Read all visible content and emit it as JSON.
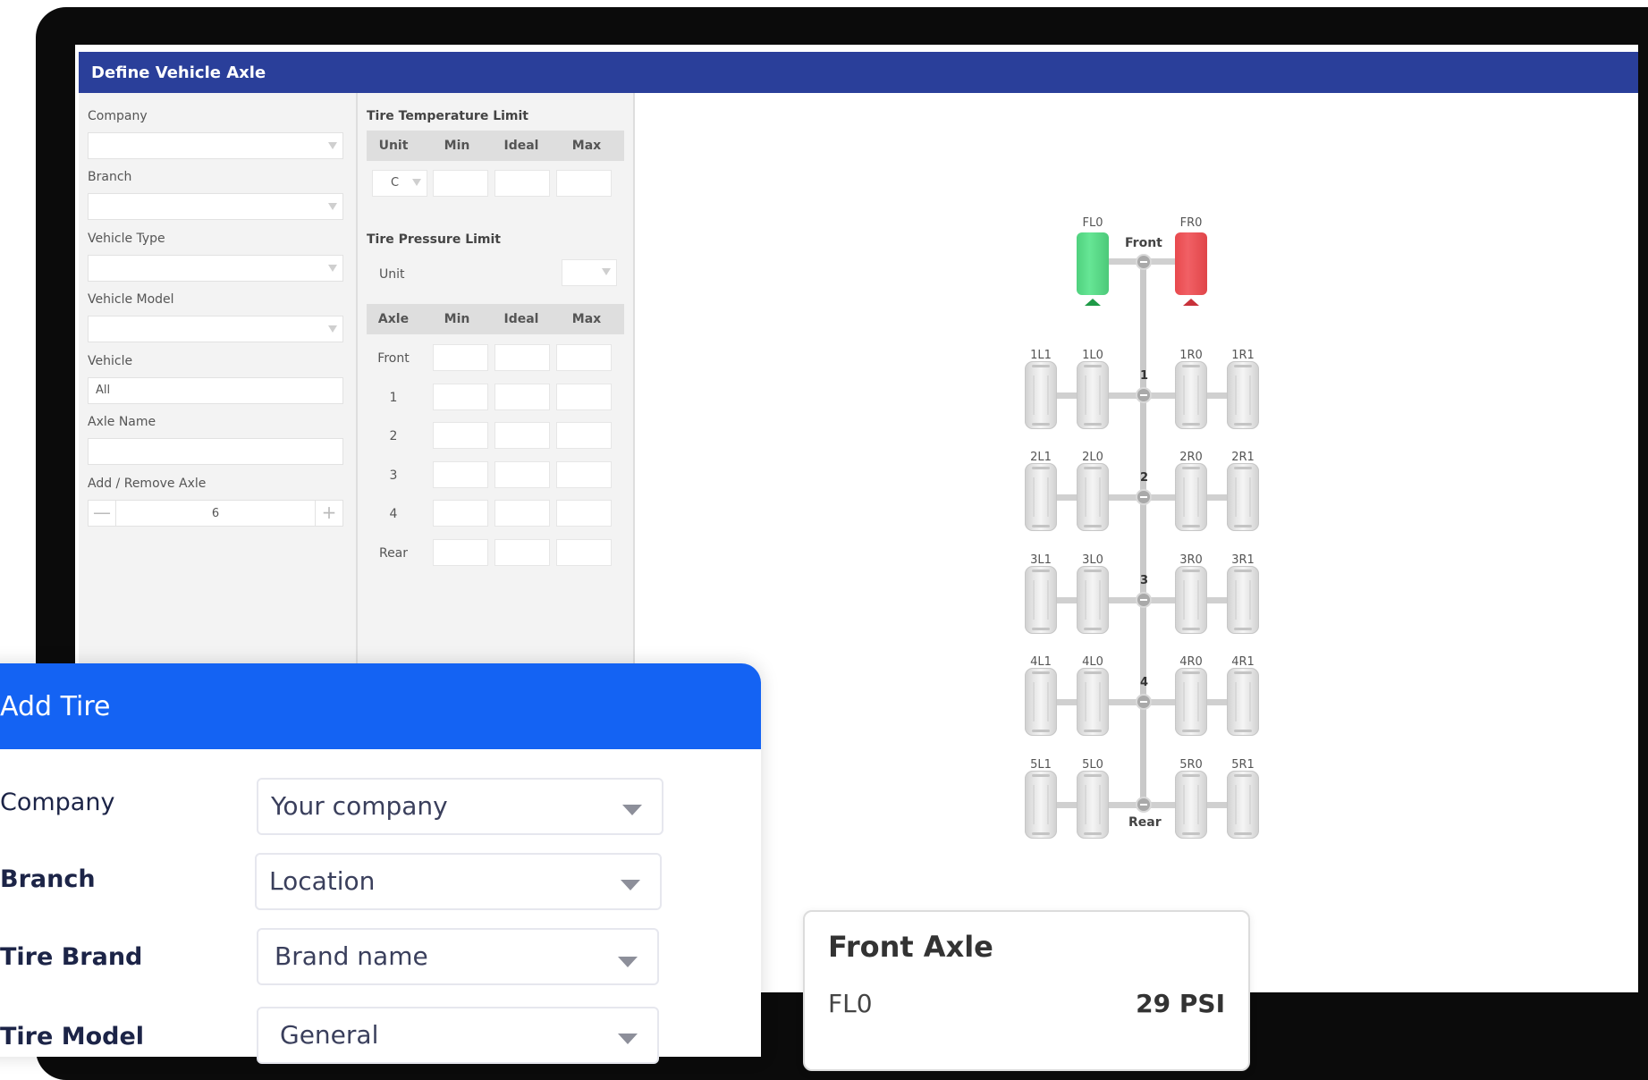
{
  "app": {
    "title": "Define Vehicle Axle"
  },
  "left_panel": {
    "company_label": "Company",
    "company_value": "",
    "branch_label": "Branch",
    "branch_value": "",
    "vehicle_type_label": "Vehicle Type",
    "vehicle_type_value": "",
    "vehicle_model_label": "Vehicle Model",
    "vehicle_model_value": "",
    "vehicle_label": "Vehicle",
    "vehicle_value": "All",
    "axle_name_label": "Axle Name",
    "axle_name_value": "",
    "add_remove_label": "Add / Remove Axle",
    "axle_count": "6",
    "minus": "—",
    "plus": "+"
  },
  "mid_panel": {
    "temp_title": "Tire Temperature Limit",
    "temp_headers": [
      "Unit",
      "Min",
      "Ideal",
      "Max"
    ],
    "temp_unit_value": "C",
    "pressure_title": "Tire Pressure Limit",
    "pressure_unit_label": "Unit",
    "pressure_unit_value": "",
    "pressure_headers": [
      "Axle",
      "Min",
      "Ideal",
      "Max"
    ],
    "pressure_rows": [
      "Front",
      "1",
      "2",
      "3",
      "4",
      "Rear"
    ]
  },
  "diagram": {
    "front_label": "Front",
    "rear_label": "Rear",
    "front_tires": [
      "FL0",
      "FR0"
    ],
    "front_status_colors": {
      "FL0": "#4fd17e",
      "FR0": "#e8494d"
    },
    "axles": [
      {
        "number": "1",
        "tires": [
          "1L1",
          "1L0",
          "1R0",
          "1R1"
        ]
      },
      {
        "number": "2",
        "tires": [
          "2L1",
          "2L0",
          "2R0",
          "2R1"
        ]
      },
      {
        "number": "3",
        "tires": [
          "3L1",
          "3L0",
          "3R0",
          "3R1"
        ]
      },
      {
        "number": "4",
        "tires": [
          "4L1",
          "4L0",
          "4R0",
          "4R1"
        ]
      },
      {
        "number": "",
        "tires": [
          "5L1",
          "5L0",
          "5R0",
          "5R1"
        ]
      }
    ]
  },
  "add_tire": {
    "title": "Add Tire",
    "company_label": "Company",
    "company_value": "Your company",
    "branch_label": "Branch",
    "branch_value": "Location",
    "brand_label": "Tire Brand",
    "brand_value": "Brand name",
    "model_label": "Tire Model",
    "model_value": "General"
  },
  "axle_card": {
    "title": "Front Axle",
    "position": "FL0",
    "pressure": "29 PSI"
  },
  "colors": {
    "app_header": "#2a3f9a",
    "add_tire_header": "#1463f3"
  }
}
